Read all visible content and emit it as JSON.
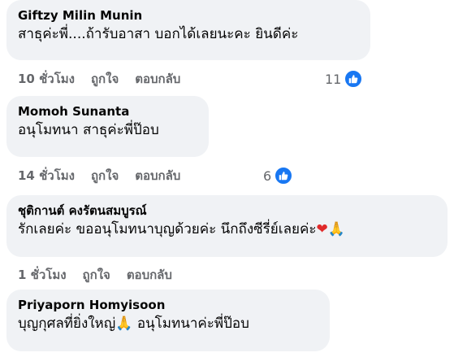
{
  "comments": [
    {
      "author": "Giftzy Milin Munin",
      "text": "สาธุค่ะพี่....ถ้ารับอาสา บอกได้เลยนะคะ ยินดีค่ะ",
      "time": "10 ชั่วโมง",
      "like_label": "ถูกใจ",
      "reply_label": "ตอบกลับ",
      "reaction_count": "11",
      "reaction_icon": "like-icon"
    },
    {
      "author": "Momoh Sunanta",
      "text": "อนุโมทนา สาธุค่ะพี่ป๊อบ",
      "time": "14 ชั่วโมง",
      "like_label": "ถูกใจ",
      "reply_label": "ตอบกลับ",
      "reaction_count": "6",
      "reaction_icon": "like-icon"
    },
    {
      "author": "ชุติกานต์ คงรัตนสมบูรณ์",
      "text": "รักเลยค่ะ ขออนุโมทนาบุญด้วยค่ะ นึกถึงซีรี่ย์เลยค่ะ",
      "emoji_heart": "❤",
      "emoji_pray": "🙏",
      "time": "1 ชั่วโมง",
      "like_label": "ถูกใจ",
      "reply_label": "ตอบกลับ"
    },
    {
      "author": "Priyaporn Homyisoon",
      "text_before": "บุญกุศลที่ยิ่งใหญ่",
      "emoji_pray": "🙏",
      "text_after": " อนุโมทนาค่ะพี่ป๊อบ"
    }
  ],
  "colors": {
    "bubble": "#f0f2f5",
    "meta_text": "#65676b",
    "like_blue": "#1877f2",
    "heart_red": "#e02a2a"
  }
}
